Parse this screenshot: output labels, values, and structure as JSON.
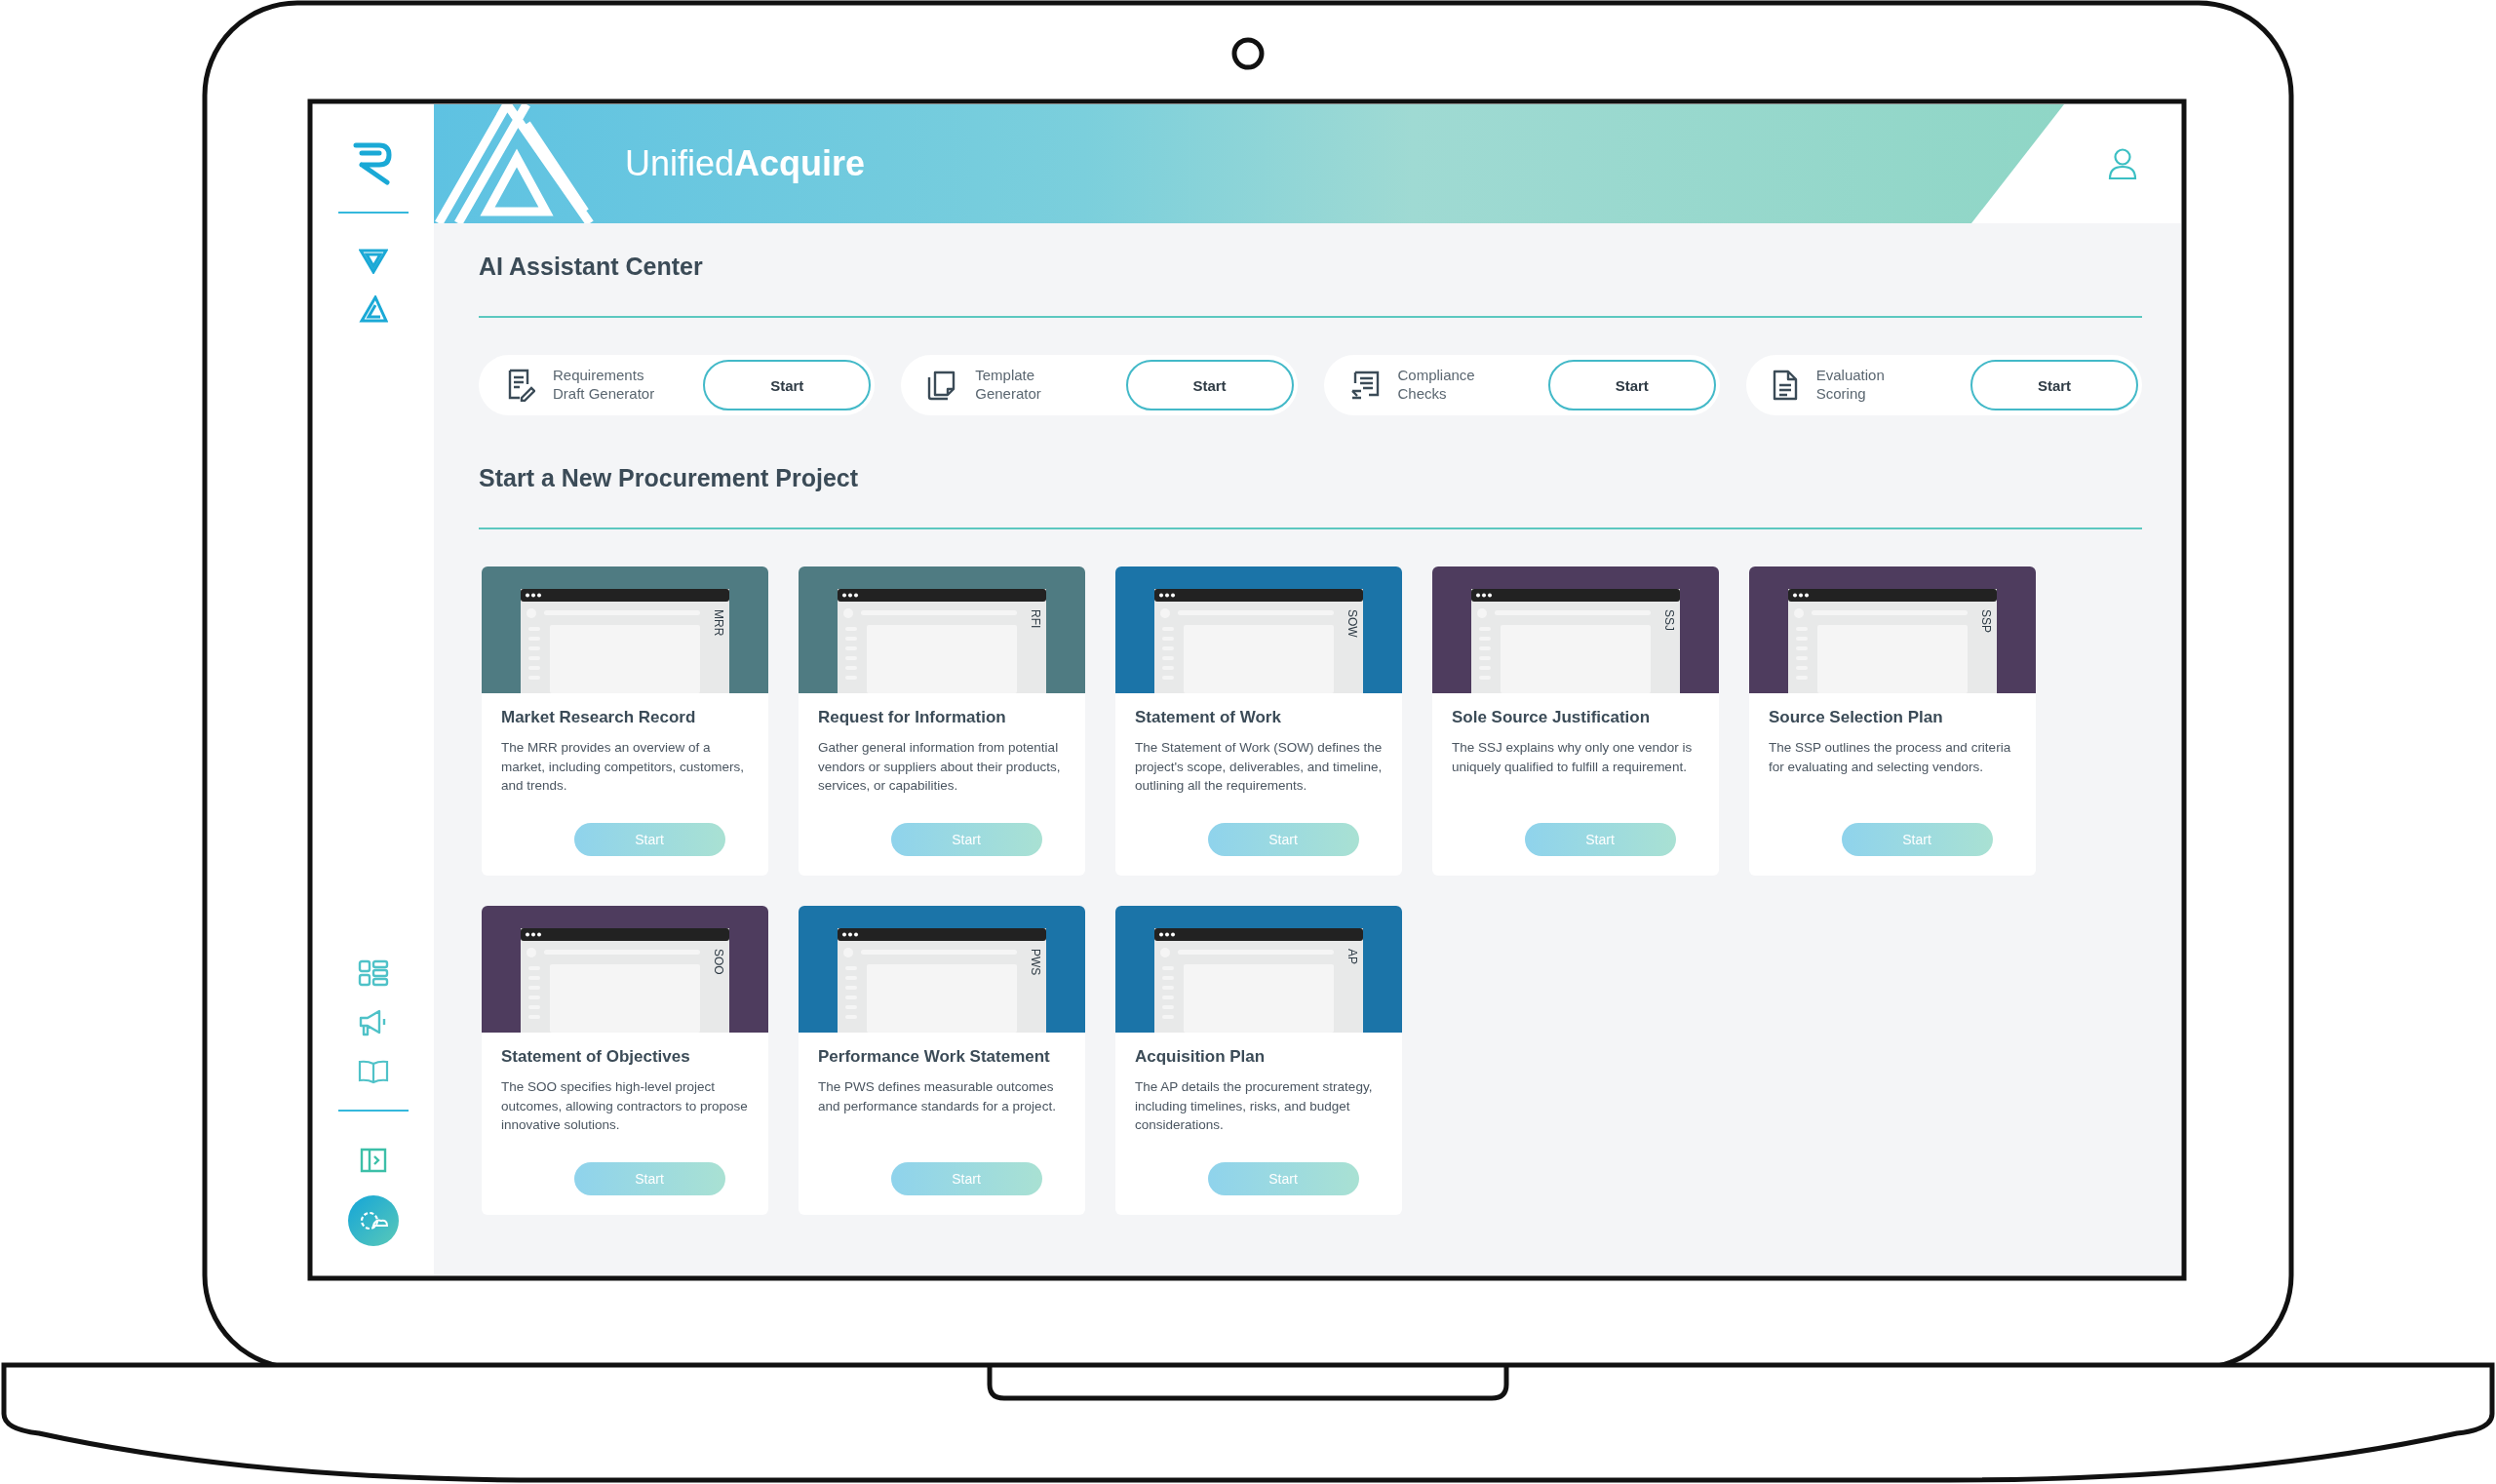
{
  "header": {
    "brand": "Unified**Acquire**"
  },
  "assistant_center": {
    "title": "AI Assistant Center",
    "tools": [
      {
        "kind": "requirements",
        "label_lines": [
          "Requirements",
          "Draft Generator"
        ],
        "button": "Start"
      },
      {
        "kind": "template",
        "label_lines": [
          "Template",
          "Generator"
        ],
        "button": "Start"
      },
      {
        "kind": "compliance",
        "label_lines": [
          "Compliance",
          "Checks"
        ],
        "button": "Start"
      },
      {
        "kind": "evaluation",
        "label_lines": [
          "Evaluation",
          "Scoring"
        ],
        "button": "Start"
      }
    ]
  },
  "new_project": {
    "title": "Start a New Procurement Project",
    "cards": [
      {
        "title": "Market Research Record",
        "abbreviation": "MRR",
        "color": "#4f7b82",
        "description": "The MRR provides an overview of a market, including competitors, customers, and trends.",
        "button": "Start"
      },
      {
        "title": "Request for Information",
        "abbreviation": "RFI",
        "color": "#4f7b82",
        "description": "Gather general information from potential vendors or suppliers about their products, services, or capabilities.",
        "button": "Start"
      },
      {
        "title": "Statement of Work",
        "abbreviation": "SOW",
        "color": "#1b74a8",
        "description": "The Statement of Work (SOW) defines the project's scope, deliverables, and timeline, outlining all the requirements.",
        "button": "Start"
      },
      {
        "title": "Sole Source Justification",
        "abbreviation": "SSJ",
        "color": "#4e3c5e",
        "description": "The SSJ explains why only one vendor is uniquely qualified to fulfill a requirement.",
        "button": "Start"
      },
      {
        "title": "Source Selection Plan",
        "abbreviation": "SSP",
        "color": "#4e3c5e",
        "description": "The SSP outlines the process and criteria for evaluating and selecting vendors.",
        "button": "Start"
      },
      {
        "title": "Statement of Objectives",
        "abbreviation": "SOO",
        "color": "#4e3c5e",
        "description": "The SOO specifies high-level project outcomes, allowing contractors to propose innovative solutions.",
        "button": "Start"
      },
      {
        "title": "Performance Work Statement",
        "abbreviation": "PWS",
        "color": "#1b74a8",
        "description": "The PWS defines measurable outcomes and performance standards for a project.",
        "button": "Start"
      },
      {
        "title": "Acquisition Plan",
        "abbreviation": "AP",
        "color": "#1b74a8",
        "description": "The AP details the procurement strategy, including timelines, risks, and budget considerations.",
        "button": "Start"
      }
    ]
  }
}
